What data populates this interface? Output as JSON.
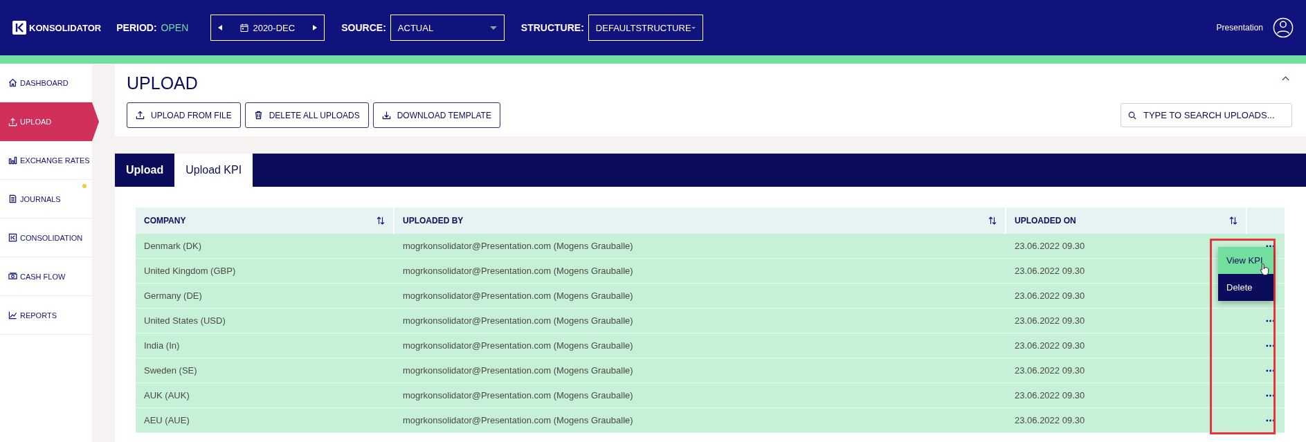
{
  "header": {
    "logo": "KONSOLIDATOR",
    "period_label": "PERIOD:",
    "period_status": "OPEN",
    "period": "2020-DEC",
    "source_label": "SOURCE:",
    "source": "ACTUAL",
    "structure_label": "STRUCTURE:",
    "structure": "DEFAULTSTRUCTURE",
    "user": "Presentation"
  },
  "sidebar": {
    "items": [
      {
        "label": "DASHBOARD",
        "kind": "home",
        "selected": false,
        "badge": false
      },
      {
        "label": "UPLOAD",
        "kind": "upload",
        "selected": true,
        "badge": false
      },
      {
        "label": "EXCHANGE RATES",
        "kind": "bars",
        "selected": false,
        "badge": false
      },
      {
        "label": "JOURNALS",
        "kind": "doc",
        "selected": false,
        "badge": true
      },
      {
        "label": "CONSOLIDATION",
        "kind": "logo",
        "selected": false,
        "badge": false
      },
      {
        "label": "CASH FLOW",
        "kind": "money",
        "selected": false,
        "badge": false
      },
      {
        "label": "REPORTS",
        "kind": "chart",
        "selected": false,
        "badge": false
      }
    ]
  },
  "page": {
    "title": "UPLOAD",
    "buttons": [
      {
        "label": "UPLOAD FROM FILE",
        "kind": "upload"
      },
      {
        "label": "DELETE ALL UPLOADS",
        "kind": "trash"
      },
      {
        "label": "DOWNLOAD TEMPLATE",
        "kind": "download"
      }
    ],
    "search": {
      "placeholder": "TYPE TO SEARCH UPLOADS..."
    }
  },
  "tabs": [
    {
      "label": "Upload",
      "selected": false
    },
    {
      "label": "Upload KPI",
      "selected": true
    }
  ],
  "table": {
    "columns": [
      {
        "label": "COMPANY"
      },
      {
        "label": "UPLOADED BY"
      },
      {
        "label": "UPLOADED ON"
      }
    ],
    "rows": [
      {
        "company": "Denmark (DK)",
        "uploaded_by": "mogrkonsolidator@Presentation.com (Mogens Grauballe)",
        "uploaded_on": "23.06.2022 09.30"
      },
      {
        "company": "United Kingdom (GBP)",
        "uploaded_by": "mogrkonsolidator@Presentation.com (Mogens Grauballe)",
        "uploaded_on": "23.06.2022 09.30"
      },
      {
        "company": "Germany (DE)",
        "uploaded_by": "mogrkonsolidator@Presentation.com (Mogens Grauballe)",
        "uploaded_on": "23.06.2022 09.30"
      },
      {
        "company": "United States (USD)",
        "uploaded_by": "mogrkonsolidator@Presentation.com (Mogens Grauballe)",
        "uploaded_on": "23.06.2022 09.30"
      },
      {
        "company": "India (In)",
        "uploaded_by": "mogrkonsolidator@Presentation.com (Mogens Grauballe)",
        "uploaded_on": "23.06.2022 09.30"
      },
      {
        "company": "Sweden (SE)",
        "uploaded_by": "mogrkonsolidator@Presentation.com (Mogens Grauballe)",
        "uploaded_on": "23.06.2022 09.30"
      },
      {
        "company": "AUK (AUK)",
        "uploaded_by": "mogrkonsolidator@Presentation.com (Mogens Grauballe)",
        "uploaded_on": "23.06.2022 09.30"
      },
      {
        "company": "AEU (AUE)",
        "uploaded_by": "mogrkonsolidator@Presentation.com (Mogens Grauballe)",
        "uploaded_on": "23.06.2022 09.30"
      }
    ]
  },
  "row_menu": {
    "items": [
      {
        "label": "View KPI",
        "selected": true
      },
      {
        "label": "Delete",
        "selected": false
      }
    ]
  }
}
